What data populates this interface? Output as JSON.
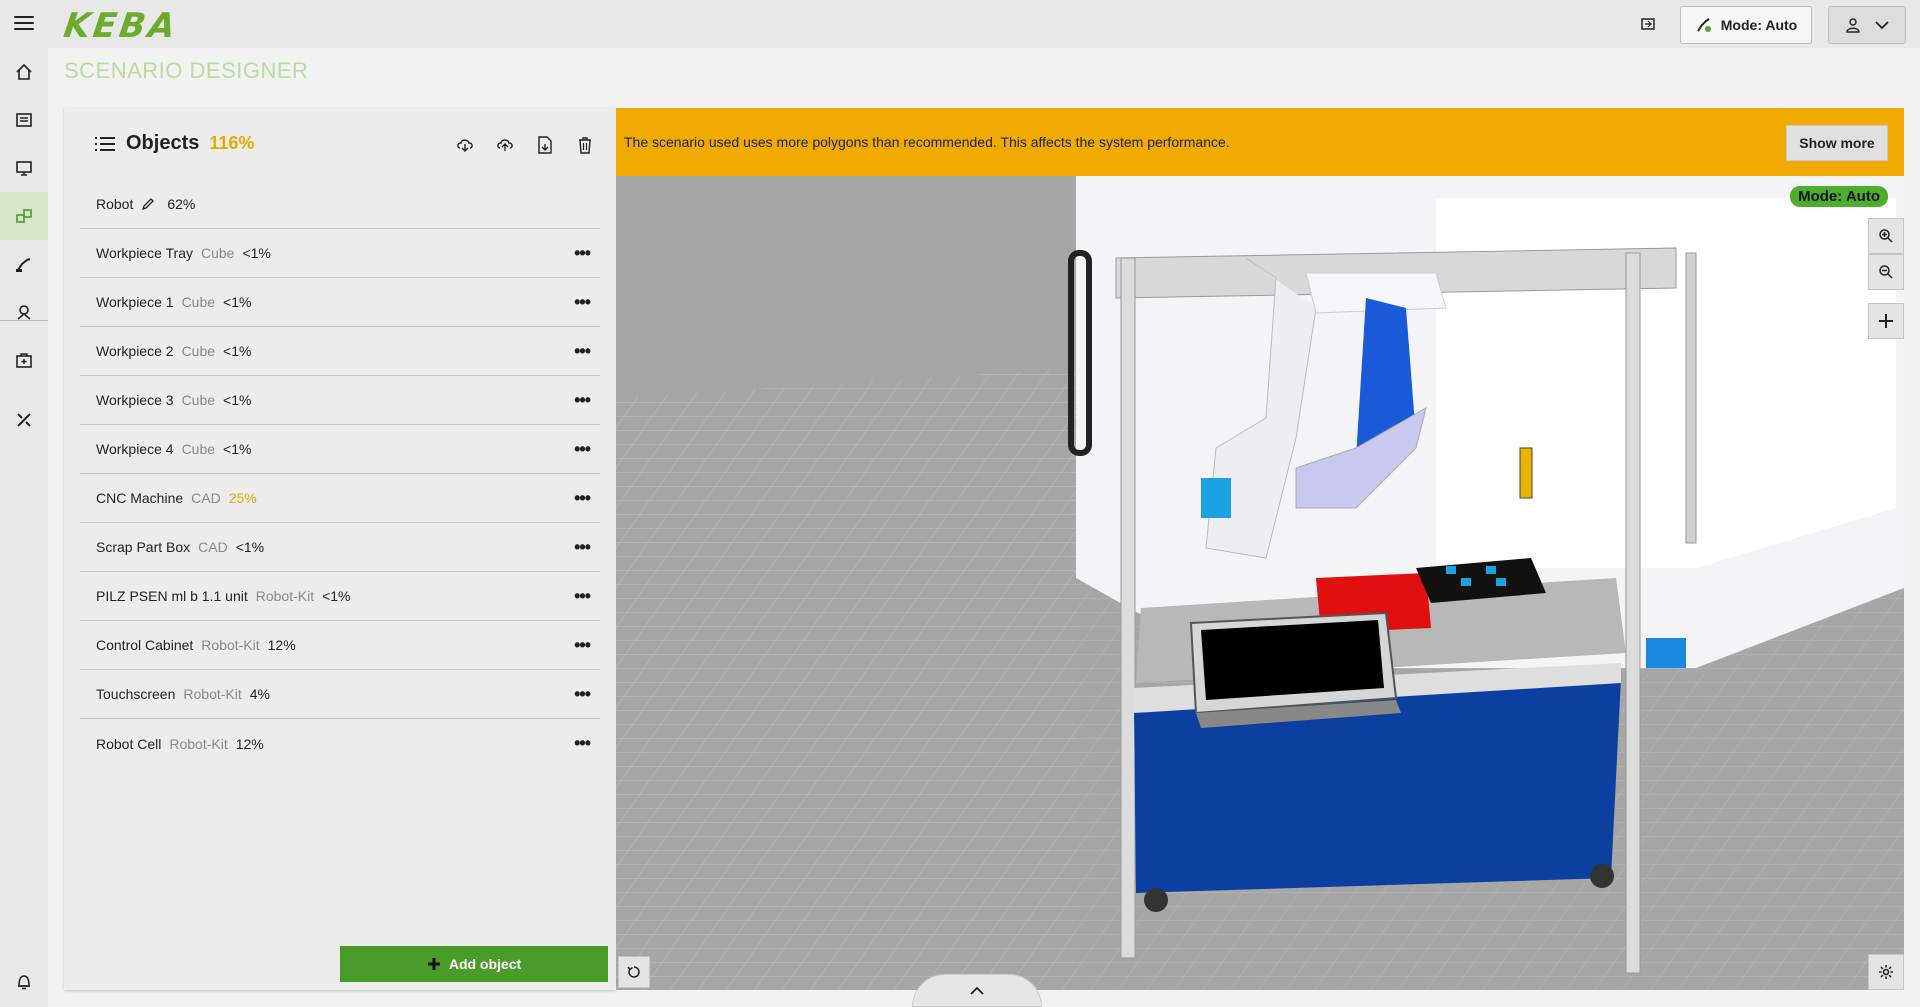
{
  "app": {
    "logo": "KEBA",
    "page_title": "SCENARIO DESIGNER",
    "mode_button": "Mode: Auto"
  },
  "nav": {
    "items": [
      "home-icon",
      "document-icon",
      "monitor-icon",
      "scenario-icon",
      "robot-arm-icon",
      "teach-icon",
      "toolbox-icon",
      "tools-icon"
    ],
    "active": "scenario-icon"
  },
  "objects": {
    "title": "Objects",
    "total": "116%",
    "items": [
      {
        "name": "Robot",
        "type": "",
        "pct": "62%"
      },
      {
        "name": "Workpiece Tray",
        "type": "Cube",
        "pct": "<1%"
      },
      {
        "name": "Workpiece 1",
        "type": "Cube",
        "pct": "<1%"
      },
      {
        "name": "Workpiece 2",
        "type": "Cube",
        "pct": "<1%"
      },
      {
        "name": "Workpiece 3",
        "type": "Cube",
        "pct": "<1%"
      },
      {
        "name": "Workpiece 4",
        "type": "Cube",
        "pct": "<1%"
      },
      {
        "name": "CNC Machine",
        "type": "CAD",
        "pct": "25%"
      },
      {
        "name": "Scrap Part Box",
        "type": "CAD",
        "pct": "<1%"
      },
      {
        "name": "PILZ PSEN ml b 1.1 unit",
        "type": "Robot-Kit",
        "pct": "<1%"
      },
      {
        "name": "Control Cabinet",
        "type": "Robot-Kit",
        "pct": "12%"
      },
      {
        "name": "Touchscreen",
        "type": "Robot-Kit",
        "pct": "4%"
      },
      {
        "name": "Robot Cell",
        "type": "Robot-Kit",
        "pct": "12%"
      }
    ],
    "more_label": "•••",
    "add_button": "Add object"
  },
  "viewport": {
    "warning": "The scenario used uses more polygons than recommended. This affects the system performance.",
    "show_more": "Show more",
    "mode_pill": "Mode: Auto"
  },
  "colors": {
    "accent": "#4a9c2a",
    "warning": "#f0aa00",
    "warn_text": "#e8a800"
  }
}
